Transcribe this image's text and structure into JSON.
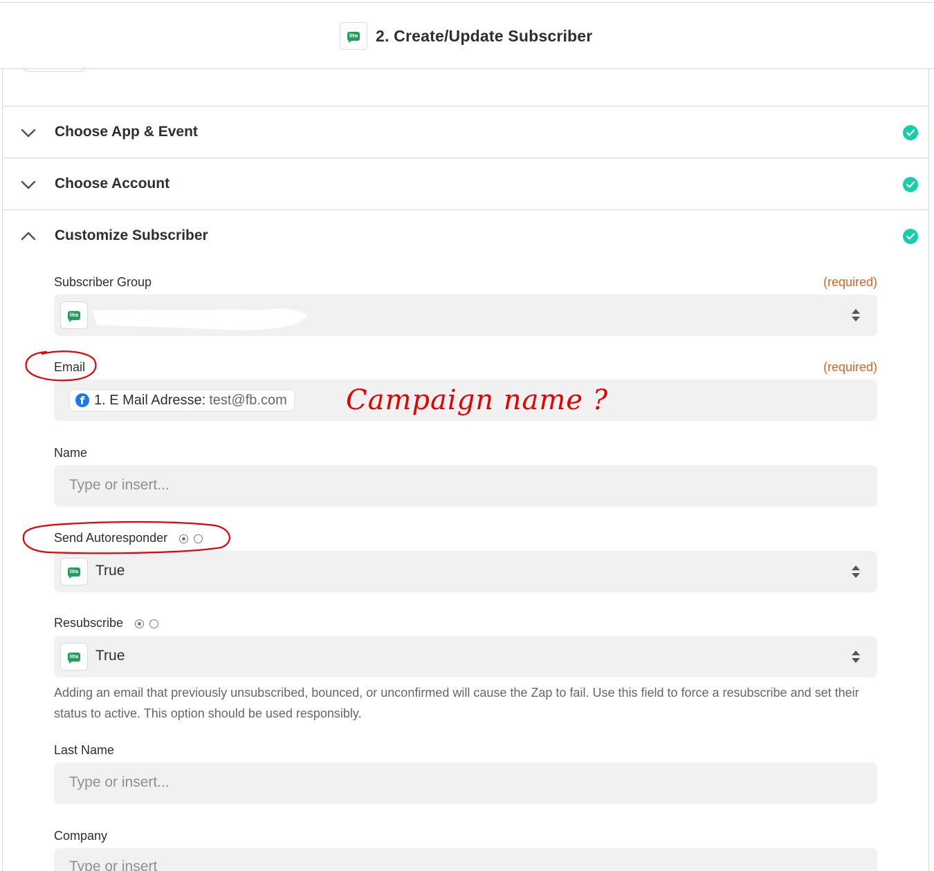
{
  "header": {
    "title": "2. Create/Update Subscriber",
    "app_badge": "lite"
  },
  "sections": [
    {
      "title": "Choose App & Event",
      "expanded": false
    },
    {
      "title": "Choose Account",
      "expanded": false
    },
    {
      "title": "Customize Subscriber",
      "expanded": true
    }
  ],
  "fields": {
    "subscriber_group": {
      "label": "Subscriber Group",
      "required": "(required)"
    },
    "email": {
      "label": "Email",
      "required": "(required)",
      "pill_label": "1. E Mail Adresse:",
      "pill_value": "test@fb.com"
    },
    "name": {
      "label": "Name",
      "placeholder": "Type or insert..."
    },
    "send_autoresponder": {
      "label": "Send Autoresponder",
      "value": "True"
    },
    "resubscribe": {
      "label": "Resubscribe",
      "value": "True",
      "help": "Adding an email that previously unsubscribed, bounced, or unconfirmed will cause the Zap to fail. Use this field to force a resubscribe and set their status to active. This option should be used responsibly."
    },
    "last_name": {
      "label": "Last Name",
      "placeholder": "Type or insert..."
    },
    "company": {
      "label": "Company",
      "placeholder": "Type or insert"
    }
  },
  "annotation": {
    "note": "Campaign name ?"
  },
  "colors": {
    "check": "#13d0ab",
    "required": "#e2621d",
    "brand": "#1fa05a",
    "annotation": "#e60000",
    "facebook": "#1877f2"
  },
  "icons": [
    "lite-app-icon",
    "chevron-down-icon",
    "chevron-up-icon",
    "check-circle-icon",
    "facebook-icon",
    "sort-arrows-icon",
    "radio-icon"
  ]
}
